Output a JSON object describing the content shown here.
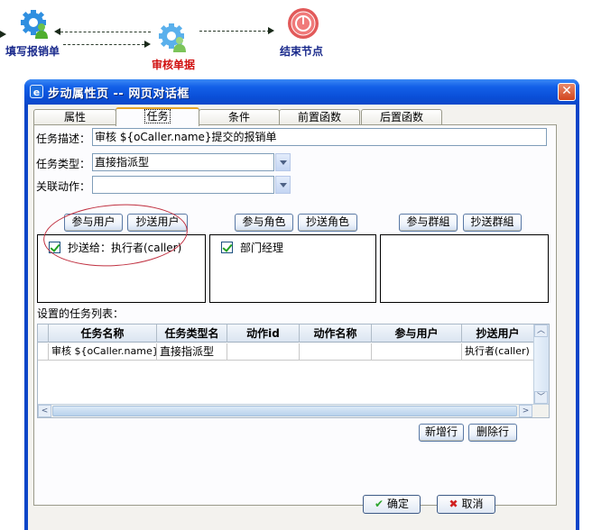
{
  "workflow": {
    "nodes": [
      {
        "label": "填写报销单",
        "type": "task",
        "color": "#1a2a8c"
      },
      {
        "label": "审核单据",
        "type": "task",
        "color": "#d01010",
        "selected": true
      },
      {
        "label": "结束节点",
        "type": "end",
        "color": "#1a2a8c"
      }
    ]
  },
  "dialog": {
    "title": "步动属性页 -- 网页对话框",
    "title_icon": "ie-icon",
    "close_icon": "close-icon",
    "tabs": [
      {
        "label": "属性",
        "active": false
      },
      {
        "label": "任务",
        "active": true
      },
      {
        "label": "条件",
        "active": false
      },
      {
        "label": "前置函数",
        "active": false
      },
      {
        "label": "后置函数",
        "active": false
      }
    ],
    "form": {
      "task_desc_label": "任务描述：",
      "task_desc_value": "审核 ${oCaller.name}提交的报销单",
      "task_type_label": "任务类型：",
      "task_type_value": "直接指派型",
      "action_label": "关联动作：",
      "action_value": ""
    },
    "assign": {
      "user_buttons": [
        "参与用户",
        "抄送用户"
      ],
      "role_buttons": [
        "参与角色",
        "抄送角色"
      ],
      "group_buttons": [
        "参与群組",
        "抄送群組"
      ],
      "users_list": [
        {
          "label": "抄送给：执行者(caller)",
          "checked": true
        }
      ],
      "roles_list": [
        {
          "label": "部门经理",
          "checked": true
        }
      ],
      "groups_list": []
    },
    "task_list": {
      "label": "设置的任务列表：",
      "columns": [
        "任务名称",
        "任务类型名",
        "动作id",
        "动作名称",
        "参与用户",
        "抄送用户"
      ],
      "rows": [
        [
          "审核 ${oCaller.name}",
          "直接指派型",
          "",
          "",
          "",
          "执行者(caller)"
        ]
      ],
      "add_row": "新增行",
      "delete_row": "删除行"
    },
    "footer": {
      "ok": "确定",
      "cancel": "取消"
    }
  }
}
